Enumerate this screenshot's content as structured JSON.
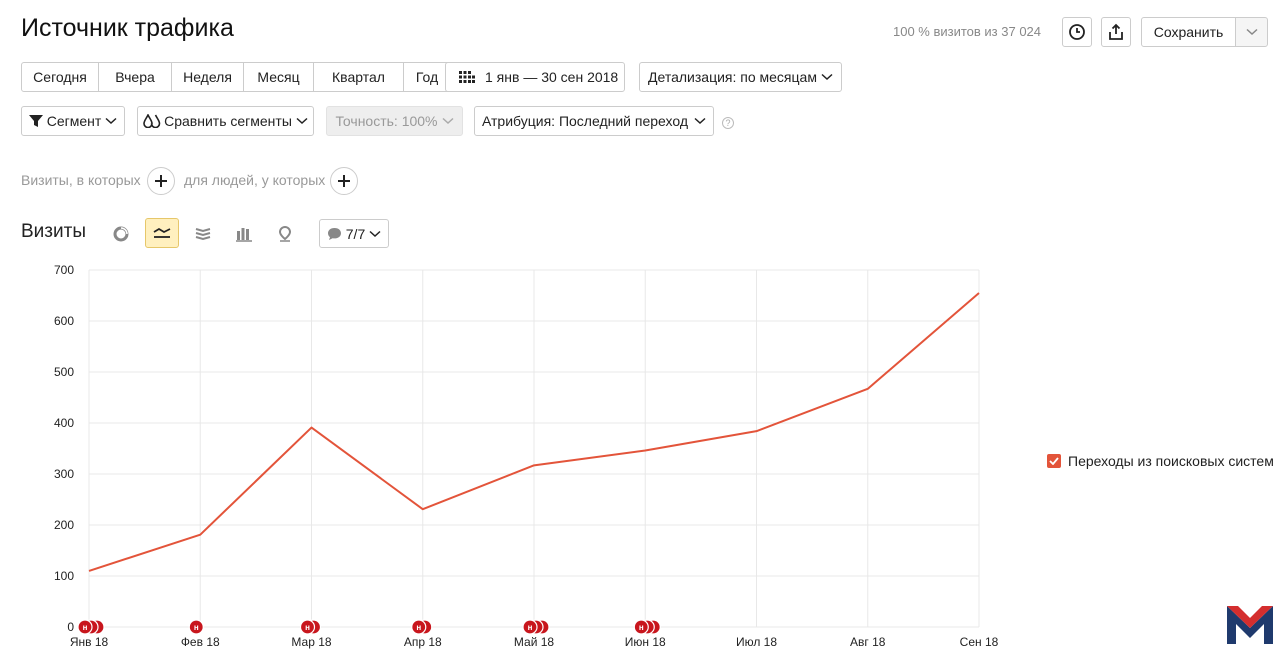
{
  "header": {
    "title": "Источник трафика",
    "visits_summary": "100 % визитов из 37 024",
    "save_label": "Сохранить"
  },
  "periods": [
    "Сегодня",
    "Вчера",
    "Неделя",
    "Месяц",
    "Квартал",
    "Год"
  ],
  "date_range": "1 янв — 30 сен 2018",
  "detail": "Детализация: по месяцам",
  "toolbar2": {
    "segment": "Сегмент",
    "compare": "Сравнить сегменты",
    "accuracy": "Точность: 100%",
    "attribution": "Атрибуция: Последний переход"
  },
  "filters": {
    "visits_label": "Визиты, в которых",
    "people_label": "для людей, у которых"
  },
  "chart_header": {
    "title": "Визиты",
    "notes_count": "7/7"
  },
  "colors": {
    "series": "#e3543a",
    "grid": "#e8e8e8",
    "accent": "#fff0bf",
    "marker": "#c8161d"
  },
  "chart_data": {
    "type": "line",
    "categories": [
      "Янв 18",
      "Фев 18",
      "Мар 18",
      "Апр 18",
      "Май 18",
      "Июн 18",
      "Июл 18",
      "Авг 18",
      "Сен 18"
    ],
    "series": [
      {
        "name": "Переходы из поисковых систем",
        "values": [
          110,
          181,
          391,
          231,
          317,
          346,
          384,
          467,
          655
        ],
        "color": "#e3543a"
      }
    ],
    "yticks": [
      0,
      100,
      200,
      300,
      400,
      500,
      600,
      700
    ],
    "ylim": [
      0,
      700
    ],
    "grid": true,
    "legend": "right",
    "annotation_markers": {
      "label": "н",
      "counts": [
        3,
        1,
        2,
        2,
        3,
        3,
        0,
        0,
        0
      ]
    }
  }
}
